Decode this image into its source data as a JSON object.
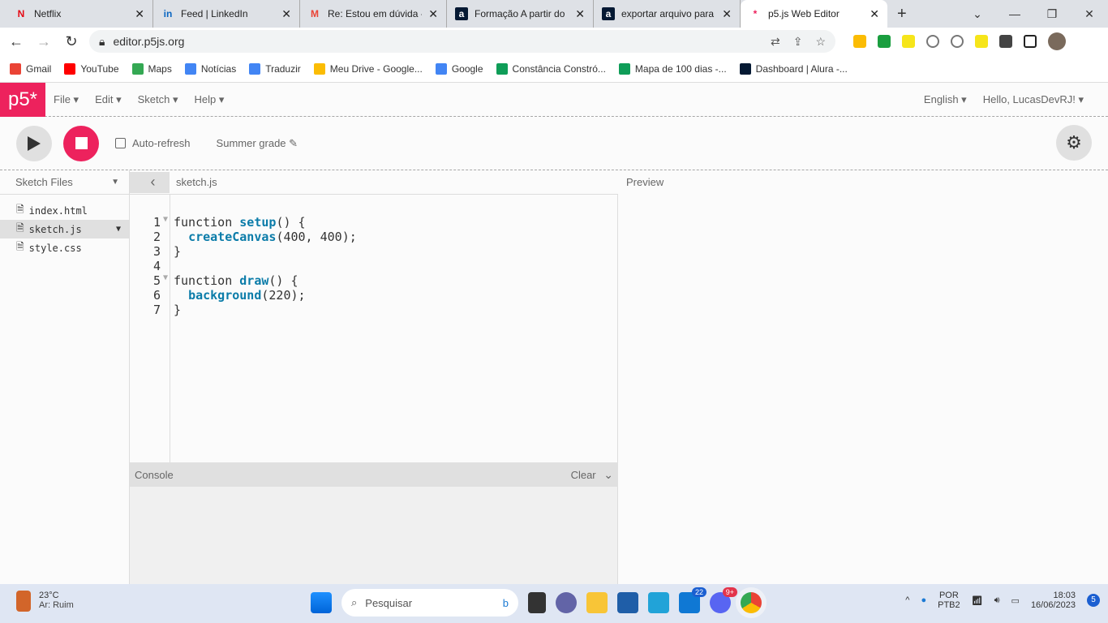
{
  "browser": {
    "tabs": [
      {
        "title": "Netflix",
        "icon": "netflix-icon",
        "color": "#e50914",
        "glyph": "N"
      },
      {
        "title": "Feed | LinkedIn",
        "icon": "linkedin-icon",
        "color": "#0a66c2",
        "glyph": "in"
      },
      {
        "title": "Re: Estou em dúvida -",
        "icon": "gmail-icon",
        "color": "#ea4335",
        "glyph": "M"
      },
      {
        "title": "Formação A partir do",
        "icon": "alura-icon",
        "color": "#051933",
        "glyph": "a"
      },
      {
        "title": "exportar arquivo para",
        "icon": "alura-icon",
        "color": "#051933",
        "glyph": "a"
      },
      {
        "title": "p5.js Web Editor",
        "icon": "p5-icon",
        "color": "#ed225d",
        "glyph": "*"
      }
    ],
    "url": "editor.p5js.org",
    "bookmarks": [
      {
        "label": "Gmail",
        "color": "#ea4335"
      },
      {
        "label": "YouTube",
        "color": "#ff0000"
      },
      {
        "label": "Maps",
        "color": "#34a853"
      },
      {
        "label": "Notícias",
        "color": "#4285f4"
      },
      {
        "label": "Traduzir",
        "color": "#4285f4"
      },
      {
        "label": "Meu Drive - Google...",
        "color": "#fbbc04"
      },
      {
        "label": "Google",
        "color": "#4285f4"
      },
      {
        "label": "Constância Constró...",
        "color": "#0f9d58"
      },
      {
        "label": "Mapa de 100 dias -...",
        "color": "#0f9d58"
      },
      {
        "label": "Dashboard | Alura -...",
        "color": "#051933"
      }
    ]
  },
  "p5": {
    "logo": "p5*",
    "menu": [
      "File ▾",
      "Edit ▾",
      "Sketch ▾",
      "Help ▾"
    ],
    "language": "English ▾",
    "user": "Hello, LucasDevRJ! ▾",
    "auto_refresh": "Auto-refresh",
    "sketch_name": "Summer grade ✎",
    "sketch_files": "Sketch Files",
    "files": [
      "index.html",
      "sketch.js",
      "style.css"
    ],
    "current_file": "sketch.js",
    "preview": "Preview",
    "console": "Console",
    "clear": "Clear",
    "accent": "#ed225d"
  },
  "code": [
    {
      "n": "1",
      "fold": "▼",
      "pre": "function ",
      "kw": "setup",
      "post": "() {"
    },
    {
      "n": "2",
      "fold": "",
      "pre": "  ",
      "kw": "createCanvas",
      "post": "(400, 400);"
    },
    {
      "n": "3",
      "fold": "",
      "pre": "}",
      "kw": "",
      "post": ""
    },
    {
      "n": "4",
      "fold": "",
      "pre": "",
      "kw": "",
      "post": ""
    },
    {
      "n": "5",
      "fold": "▼",
      "pre": "function ",
      "kw": "draw",
      "post": "() {"
    },
    {
      "n": "6",
      "fold": "",
      "pre": "  ",
      "kw": "background",
      "post": "(220);"
    },
    {
      "n": "7",
      "fold": "",
      "pre": "}",
      "kw": "",
      "post": ""
    }
  ],
  "taskbar": {
    "temp": "23°C",
    "weather": "Ar: Ruim",
    "search": "Pesquisar",
    "badge_mail": "22",
    "badge_discord": "9+",
    "lang1": "POR",
    "lang2": "PTB2",
    "time": "18:03",
    "date": "16/06/2023",
    "notif": "5"
  }
}
